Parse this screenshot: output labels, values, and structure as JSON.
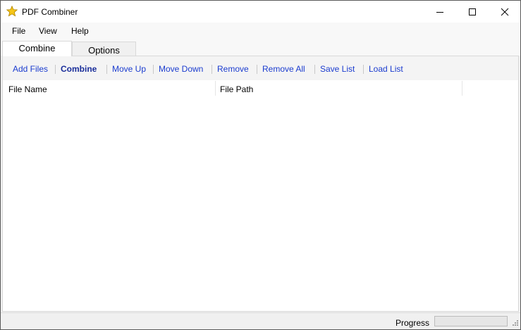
{
  "window": {
    "title": "PDF Combiner",
    "icons": [
      "star-icon",
      "minimize-icon",
      "maximize-icon",
      "close-icon"
    ]
  },
  "menu": {
    "file": "File",
    "view": "View",
    "help": "Help"
  },
  "tabs": {
    "combine": "Combine",
    "options": "Options",
    "active": "Combine"
  },
  "toolbar": {
    "add_files": "Add Files",
    "combine": "Combine",
    "move_up": "Move Up",
    "move_down": "Move Down",
    "remove": "Remove",
    "remove_all": "Remove All",
    "save_list": "Save List",
    "load_list": "Load List"
  },
  "list": {
    "columns": [
      "File Name",
      "File Path"
    ],
    "rows": []
  },
  "status": {
    "progress_label": "Progress",
    "progress_value": 0
  },
  "colors": {
    "link": "#1b3ccf",
    "star": "#f5c518"
  }
}
